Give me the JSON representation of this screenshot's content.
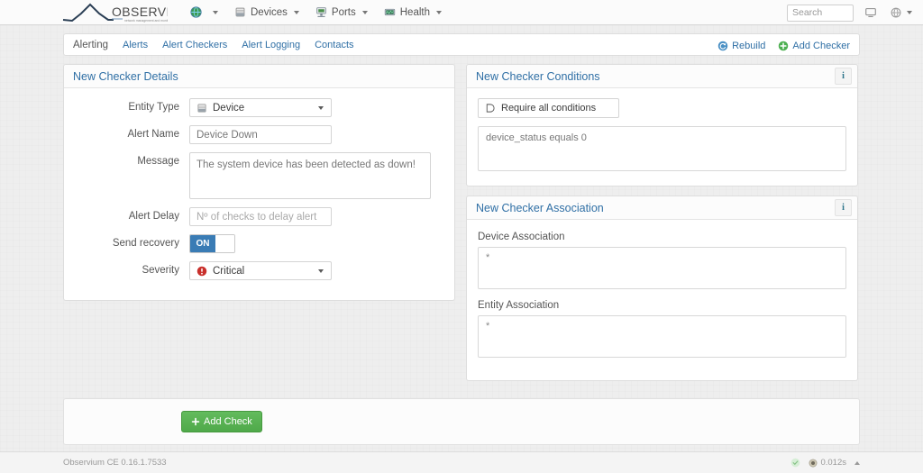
{
  "navbar": {
    "brand": "OBSERVIUM",
    "brand_tagline": "network management and monitoring",
    "items": [
      {
        "label": "",
        "icon": "globe-icon"
      },
      {
        "label": "Devices",
        "icon": "device-rack-icon"
      },
      {
        "label": "Ports",
        "icon": "port-network-icon"
      },
      {
        "label": "Health",
        "icon": "health-chart-icon"
      }
    ],
    "search_placeholder": "Search",
    "search_value": "",
    "console_icon": "console-monitor-icon",
    "settings_icon": "globe-settings-icon"
  },
  "subnav": {
    "title": "Alerting",
    "links": [
      {
        "label": "Alerts"
      },
      {
        "label": "Alert Checkers"
      },
      {
        "label": "Alert Logging"
      },
      {
        "label": "Contacts"
      }
    ],
    "rebuild_label": "Rebuild",
    "add_checker_label": "Add Checker"
  },
  "details_panel": {
    "title": "New Checker Details",
    "entity_type_label": "Entity Type",
    "entity_type_value": "Device",
    "alert_name_label": "Alert Name",
    "alert_name_value": "Device Down",
    "message_label": "Message",
    "message_value": "The system device has been detected as down!",
    "alert_delay_label": "Alert Delay",
    "alert_delay_value": "",
    "alert_delay_placeholder": "Nº of checks to delay alert",
    "send_recovery_label": "Send recovery",
    "send_recovery_state": "ON",
    "severity_label": "Severity",
    "severity_value": "Critical"
  },
  "conditions_panel": {
    "title": "New Checker Conditions",
    "info_label": "i",
    "require_label": "Require all conditions",
    "conditions_value": "device_status equals 0"
  },
  "association_panel": {
    "title": "New Checker Association",
    "info_label": "i",
    "device_association_label": "Device Association",
    "device_association_value": "*",
    "entity_association_label": "Entity Association",
    "entity_association_value": "*"
  },
  "actions": {
    "add_check_label": "Add Check"
  },
  "footer": {
    "version": "Observium CE 0.16.1.7533",
    "load_time": "0.012s"
  },
  "colors": {
    "accent_blue": "#2f6fa5",
    "toggle_blue": "#3a7cb5",
    "success_green": "#4fa94a",
    "critical_red": "#c9302c",
    "page_bg": "#eeeeee",
    "panel_bg": "#ffffff"
  }
}
